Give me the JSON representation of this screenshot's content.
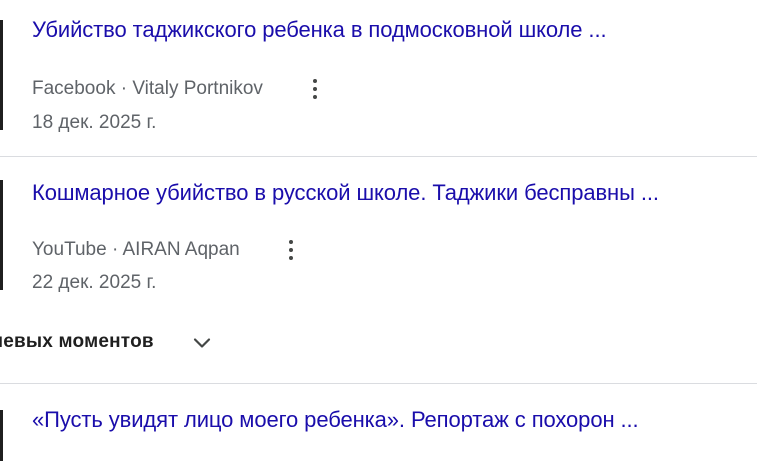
{
  "results": [
    {
      "title": "Убийство таджикского ребенка в подмосковной школе ...",
      "source": "Facebook · Vitaly Portnikov",
      "date": "18 дек. 2025 г.",
      "menu_icon": "more-vert-icon"
    },
    {
      "title": "Кошмарное убийство в русской школе. Таджики бесправны ...",
      "source": "YouTube · AIRAN Aqpan",
      "date": "22 дек. 2025 г.",
      "menu_icon": "more-vert-icon"
    },
    {
      "title": "«Пусть увидят лицо моего ребенка». Репортаж с похорон ..."
    }
  ],
  "key_moments": {
    "label": "чевых моментов",
    "icon": "chevron-down-icon"
  },
  "colors": {
    "link": "#1a0dab",
    "meta": "#5f6368",
    "divider": "#dadce0"
  }
}
